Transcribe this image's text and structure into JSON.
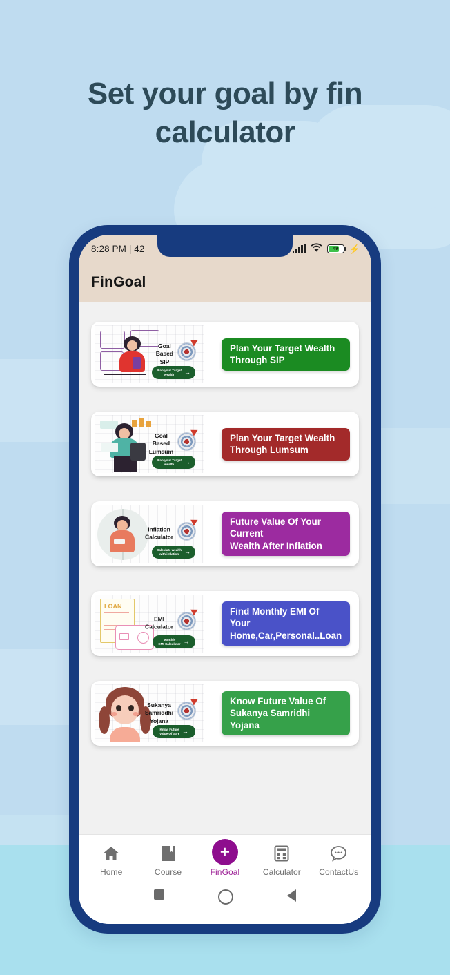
{
  "page": {
    "headline": "Set your goal by  fin\ncalculator",
    "headline_color": "#2d4a58",
    "background_color": "#bfdcf0",
    "sea_color": "#a9e0ee"
  },
  "phone": {
    "frame_color": "#173b7f",
    "statusbar": {
      "time_and_text": "8:28 PM | 42",
      "signal_icon": "signal-bars-icon",
      "wifi_icon": "wifi-icon",
      "battery_level": "49",
      "battery_icon": "battery-icon",
      "charging_icon": "charging-bolt-icon"
    },
    "appbar": {
      "title": "FinGoal",
      "background_color": "#e7d9cb"
    }
  },
  "cards": [
    {
      "illustration_label": "Goal\nBased\nSIP",
      "illustration_pill": "Plan your Target\nwealth",
      "illustration_icon": "dartboard-target-icon",
      "cta_label": "Plan Your Target Wealth\nThrough SIP",
      "cta_color": "#1b8b22",
      "name": "goal-based-sip"
    },
    {
      "illustration_label": "Goal\nBased\nLumsum",
      "illustration_pill": "Plan your Target\nwealth",
      "illustration_icon": "dartboard-target-icon",
      "cta_label": "Plan Your Target Wealth\nThrough Lumsum",
      "cta_color": "#a32a2a",
      "name": "goal-based-lumsum"
    },
    {
      "illustration_label": "Inflation\nCalculator",
      "illustration_pill": "Calculate wealth\nwith inflation",
      "illustration_icon": "dartboard-target-icon",
      "cta_label": "Future Value Of Your Current\nWealth After Inflation",
      "cta_color": "#9c2ba0",
      "name": "inflation-calculator"
    },
    {
      "illustration_label": "EMI\nCalculator",
      "illustration_pill": "Monthly\nEMI Calculator",
      "illustration_icon": "dartboard-target-icon",
      "illustration_doc_text": "LOAN",
      "cta_label": "Find Monthly EMI Of Your\nHome,Car,Personal..Loan",
      "cta_color": "#4a52c8",
      "name": "emi-calculator"
    },
    {
      "illustration_label": "Sukanya\nSamriddhi\nYojana",
      "illustration_pill": "Know Future\nValue Of SSY",
      "illustration_icon": "dartboard-target-icon",
      "cta_label": "Know Future Value Of\nSukanya Samridhi Yojana",
      "cta_color": "#36a14a",
      "name": "sukanya-samriddhi-yojana"
    }
  ],
  "bottom_nav": {
    "active_color": "#9c1f95",
    "items": [
      {
        "label": "Home",
        "icon": "home-icon",
        "active": false
      },
      {
        "label": "Course",
        "icon": "book-icon",
        "active": false
      },
      {
        "label": "FinGoal",
        "icon": "plus-circle-icon",
        "active": true
      },
      {
        "label": "Calculator",
        "icon": "calculator-icon",
        "active": false
      },
      {
        "label": "ContactUs",
        "icon": "chat-bubble-icon",
        "active": false
      }
    ]
  },
  "system_nav": {
    "back_icon": "triangle-back-icon",
    "home_icon": "circle-home-icon",
    "recents_icon": "square-recents-icon"
  }
}
